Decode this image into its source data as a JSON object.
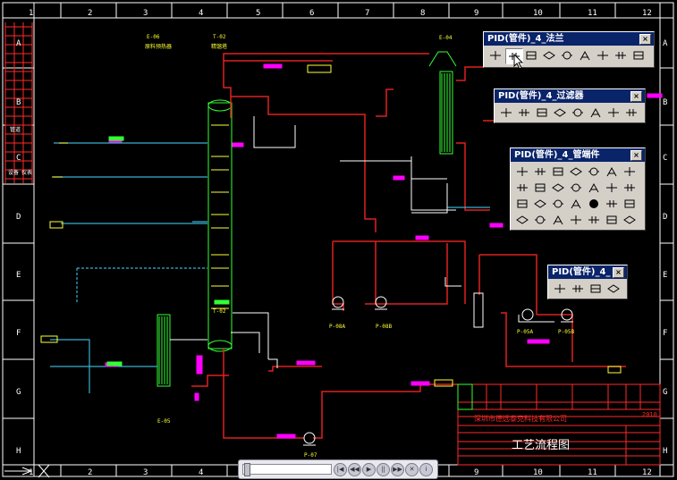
{
  "drawing": {
    "columns": [
      "1",
      "2",
      "3",
      "4",
      "5",
      "6",
      "7",
      "8",
      "9",
      "10",
      "11",
      "12"
    ],
    "rows": [
      "A",
      "B",
      "C",
      "D",
      "E",
      "F",
      "G",
      "H"
    ],
    "equipment_labels": [
      {
        "id": "e01",
        "text": "E-06"
      },
      {
        "id": "e02",
        "text": "原料预热器"
      },
      {
        "id": "e03",
        "text": "T-02"
      },
      {
        "id": "e04",
        "text": "精馏塔"
      },
      {
        "id": "e05",
        "text": "E-04"
      },
      {
        "id": "e06",
        "text": "P-08A"
      },
      {
        "id": "e07",
        "text": "P-08B"
      },
      {
        "id": "e08",
        "text": "P-05A"
      },
      {
        "id": "e09",
        "text": "P-05B"
      },
      {
        "id": "e10",
        "text": "E-05"
      },
      {
        "id": "e11",
        "text": "P-07"
      },
      {
        "id": "e12",
        "text": "T-02"
      }
    ],
    "side_table": [
      "管道",
      "设备",
      "仪表"
    ]
  },
  "title_block": {
    "company": "深圳市德远泰克科技有限公司",
    "drawing_title": "工艺流程图",
    "year": "2010"
  },
  "toolbars": [
    {
      "id": "flange",
      "title": "PID(管件)_4_法兰",
      "close": "×",
      "tools": [
        "flange-end-icon",
        "flange-pair-icon",
        "flange-blind-icon",
        "flange-weld-icon",
        "flange-slip-icon",
        "flange-socket-icon",
        "flange-thread-icon",
        "flange-lap-icon",
        "flange-ring-icon"
      ]
    },
    {
      "id": "filter",
      "title": "PID(管件)_4_过滤器",
      "close": "×",
      "tools": [
        "y-filter-icon",
        "t-filter-icon",
        "basket-filter-icon",
        "cone-filter-icon",
        "duplex-filter-icon",
        "strainer-icon",
        "bag-filter-icon",
        "cartridge-filter-icon"
      ]
    },
    {
      "id": "fitting",
      "title": "PID(管件)_4_管端件",
      "close": "×",
      "tools": [
        "elbow-icon",
        "bend-icon",
        "reducer-icon",
        "funnel-icon",
        "vent-icon",
        "y-branch-icon",
        "tee-icon",
        "split-icon",
        "arrow-up-icon",
        "box-icon",
        "wedge-icon",
        "cap-icon",
        "plug-icon",
        "oval-icon",
        "end-cap-icon",
        "blind-cap-icon",
        "dash-end-icon",
        "stub-icon",
        "ball-icon",
        "nozzle-icon",
        "grid-icon",
        "bow-icon",
        "diamond-icon",
        "trap-icon",
        "s-icon",
        "square-icon",
        "union-icon",
        "cross-icon"
      ]
    },
    {
      "id": "misc",
      "title": "PID(管件)_4_",
      "close": "×",
      "tools": [
        "spool-icon",
        "sight-glass-icon",
        "orifice-icon",
        "expansion-joint-icon"
      ]
    }
  ],
  "player": {
    "buttons": [
      "|◀",
      "◀◀",
      "▶",
      "||",
      "▶▶",
      "✕",
      "i"
    ]
  },
  "colors": {
    "frame": "#ff2a2a",
    "pipe_red": "#e02020",
    "cyan": "#38b0d0",
    "green": "#33ff33",
    "yellow": "#ffff33",
    "magenta": "#ff00ff",
    "white": "#ffffff"
  }
}
